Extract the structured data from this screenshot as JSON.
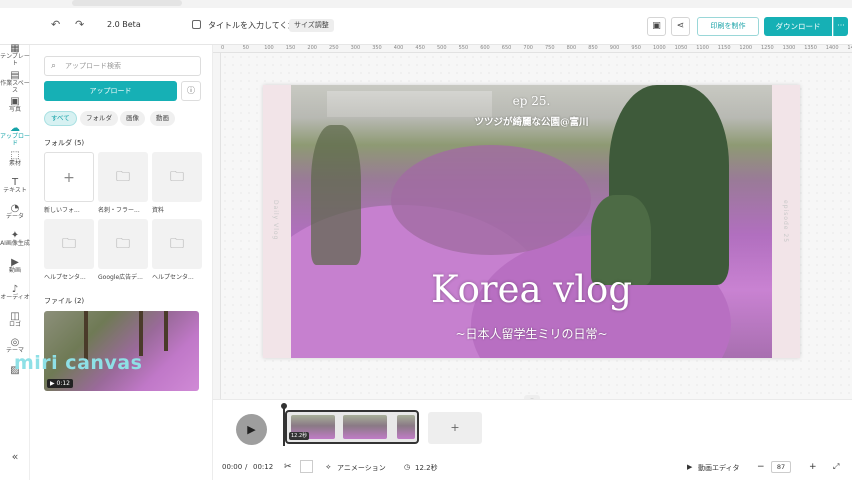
{
  "topbar": {
    "undo_icon": "undo-icon",
    "redo_icon": "redo-icon",
    "beta": "2.0 Beta",
    "title_placeholder": "タイトルを入力してくた",
    "size_button": "サイズ調整",
    "print_button": "印刷を制作",
    "download_button": "ダウンロード",
    "more": "···"
  },
  "rail": [
    {
      "label": "テンプレート",
      "icon": "▦"
    },
    {
      "label": "作業スペース",
      "icon": "▤"
    },
    {
      "label": "写真",
      "icon": "▣"
    },
    {
      "label": "アップロード",
      "icon": "☁"
    },
    {
      "label": "素材",
      "icon": "⬚"
    },
    {
      "label": "テキスト",
      "icon": "T"
    },
    {
      "label": "データ",
      "icon": "◔"
    },
    {
      "label": "AI画像生成",
      "icon": "✦"
    },
    {
      "label": "動画",
      "icon": "▶"
    },
    {
      "label": "オーディオ",
      "icon": "♪"
    },
    {
      "label": "ロゴ",
      "icon": "◫"
    },
    {
      "label": "テーマ",
      "icon": "◎"
    },
    {
      "label": "",
      "icon": "▨"
    }
  ],
  "rail_collapse": "«",
  "panel": {
    "search_placeholder": "アップロード検索",
    "upload_button": "アップロード",
    "info": "ⓘ",
    "chips": [
      "すべて",
      "フォルダ",
      "画像",
      "動画"
    ],
    "folders_heading": "フォルダ (5)",
    "folders": [
      {
        "label": "新しいフォ...",
        "new": true
      },
      {
        "label": "名刺・フラー...",
        "new": false
      },
      {
        "label": "資料",
        "new": false
      },
      {
        "label": "ヘルプセンタ...",
        "new": false
      },
      {
        "label": "Google広告デ...",
        "new": false
      },
      {
        "label": "ヘルプセンタ...",
        "new": false
      }
    ],
    "files_heading": "ファイル (2)",
    "video_duration": "▶ 0:12"
  },
  "brand": "miri canvas",
  "ruler": [
    "0",
    "50",
    "100",
    "150",
    "200",
    "250",
    "300",
    "350",
    "400",
    "450",
    "500",
    "550",
    "600",
    "650",
    "700",
    "750",
    "800",
    "850",
    "900",
    "950",
    "1000",
    "1050",
    "1100",
    "1150",
    "1200",
    "1250",
    "1300",
    "1350",
    "1400",
    "1450"
  ],
  "canvas": {
    "episode": "ep 25.",
    "subtitle_top": "ツツジが綺麗な公園@富川",
    "title": "Korea vlog",
    "subtitle_bottom": "~日本人留学生ミリの日常~",
    "side_left": "Daily Vlog",
    "side_right": "episode 25"
  },
  "timeline": {
    "clip_duration": "12.2秒",
    "add": "+"
  },
  "bottom": {
    "current_time": "00:00",
    "separator": "/",
    "total_time": "00:12",
    "animation": "アニメーション",
    "duration": "12.2秒",
    "video_editor": "動画エディタ",
    "zoom_minus": "−",
    "zoom": "87",
    "zoom_plus": "+"
  }
}
